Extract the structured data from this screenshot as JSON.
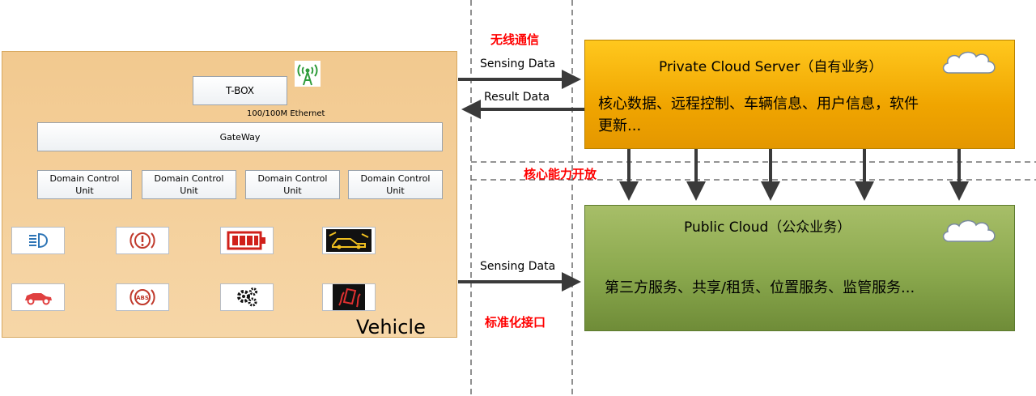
{
  "vehicle": {
    "label": "Vehicle",
    "tbox": "T-BOX",
    "ethernet": "100/100M Ethernet",
    "gateway": "GateWay",
    "dcu_line1": "Domain Control",
    "dcu_line2": "Unit",
    "ecu_icons": [
      "headlight-icon",
      "brake-warning-icon",
      "battery-icon",
      "lane-departure-icon",
      "car-icon",
      "abs-icon",
      "gears-icon",
      "skid-icon"
    ]
  },
  "channel": {
    "wireless": "无线通信",
    "standard": "标准化接口",
    "core_open": "核心能力开放",
    "sensing_top": "Sensing Data",
    "result": "Result Data",
    "sensing_bottom": "Sensing Data"
  },
  "private_cloud": {
    "title": "Private Cloud Server（自有业务）",
    "line1": "核心数据、远程控制、车辆信息、用户信息，软件",
    "line2": "更新..."
  },
  "public_cloud": {
    "title": "Public Cloud（公众业务）",
    "body": "第三方服务、共享/租赁、位置服务、监管服务..."
  },
  "colors": {
    "private_fill": "#f0a500",
    "public_fill": "#8aa84d",
    "vehicle_fill": "#f4cf9b",
    "label_red": "#ff0000",
    "bus_blue": "#2e75b6"
  }
}
